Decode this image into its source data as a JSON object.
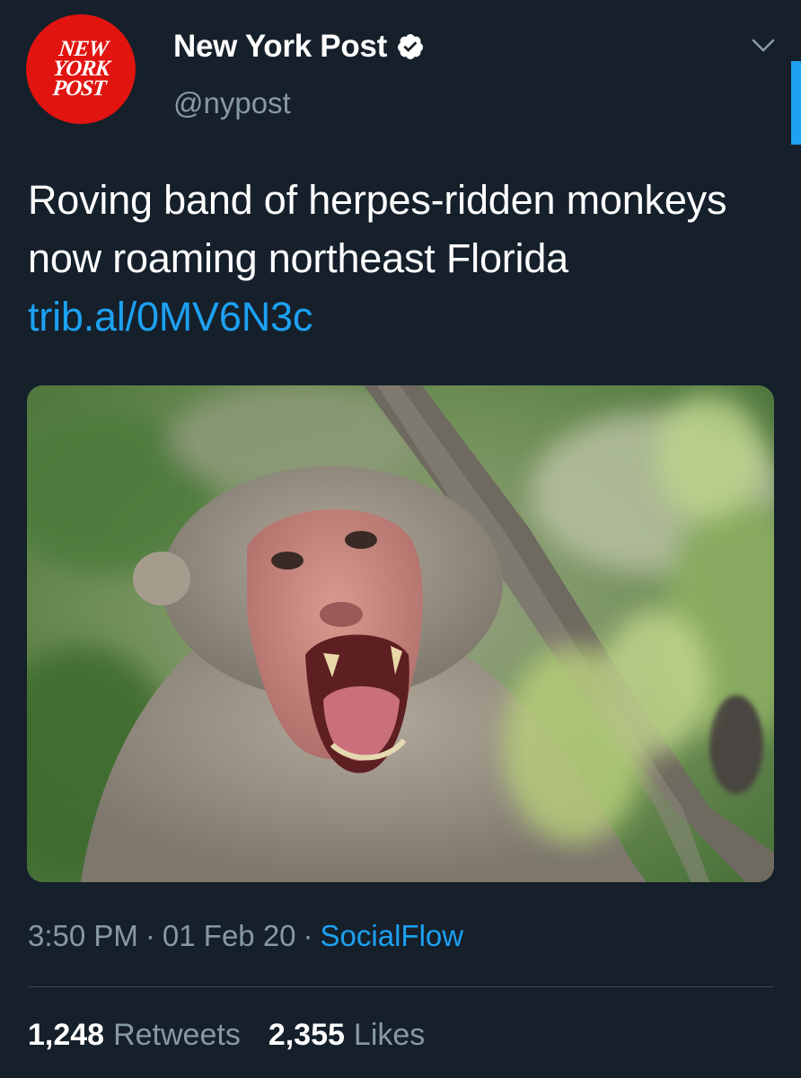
{
  "header": {
    "avatar_logo_text": "NEW\nYORK\nPOST",
    "display_name": "New York Post",
    "handle": "@nypost",
    "verified_icon": "verified-badge-icon",
    "menu_icon": "chevron-down-icon"
  },
  "tweet": {
    "text": "Roving band of herpes-ridden monkeys now roaming northeast Florida ",
    "link": "trib.al/0MV6N3c"
  },
  "media": {
    "subject": "monkey-photo"
  },
  "meta": {
    "time": "3:50 PM",
    "separator": "·",
    "date": "01 Feb 20",
    "source": "SocialFlow"
  },
  "stats": {
    "retweets_count": "1,248",
    "retweets_label": "Retweets",
    "likes_count": "2,355",
    "likes_label": "Likes"
  },
  "colors": {
    "background": "#15202b",
    "accent": "#1da1f2",
    "muted": "#8899a6",
    "divider": "#38444d",
    "brand_red": "#e1140f"
  }
}
